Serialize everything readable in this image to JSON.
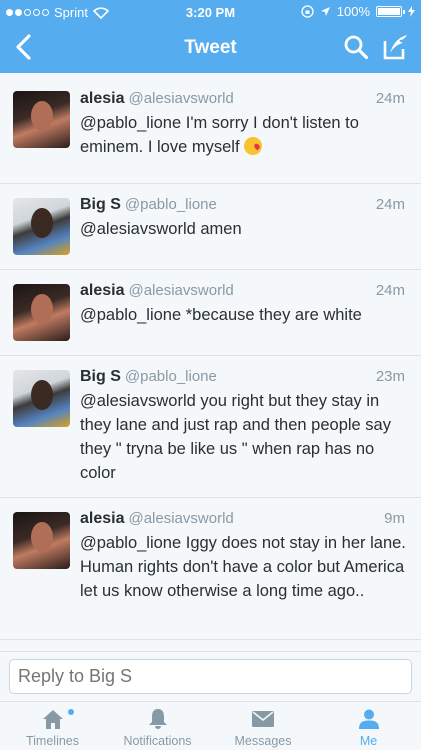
{
  "status_bar": {
    "carrier": "Sprint",
    "time": "3:20 PM",
    "battery": "100%"
  },
  "nav": {
    "title": "Tweet"
  },
  "tweets": [
    {
      "name": "alesia",
      "handle": "@alesiavsworld",
      "time": "24m",
      "text": "@pablo_lione I'm sorry I don't listen to eminem. I love myself",
      "emoji": "kissing-face-emoji",
      "avatar": "alesia"
    },
    {
      "name": "Big S",
      "handle": "@pablo_lione",
      "time": "24m",
      "text": "@alesiavsworld amen",
      "avatar": "bigs"
    },
    {
      "name": "alesia",
      "handle": "@alesiavsworld",
      "time": "24m",
      "text": "@pablo_lione *because they are white",
      "avatar": "alesia"
    },
    {
      "name": "Big S",
      "handle": "@pablo_lione",
      "time": "23m",
      "text": "@alesiavsworld you right but they stay in they lane and just rap and then people say they \" tryna be like us \" when rap has no color",
      "avatar": "bigs"
    },
    {
      "name": "alesia",
      "handle": "@alesiavsworld",
      "time": "9m",
      "text": "@pablo_lione Iggy does not stay in her lane. Human rights don't have a color but America let us know otherwise a long time ago..",
      "avatar": "alesia"
    }
  ],
  "reply": {
    "placeholder": "Reply to Big S"
  },
  "tabs": [
    {
      "label": "Timelines",
      "icon": "home-icon",
      "active": false
    },
    {
      "label": "Notifications",
      "icon": "bell-icon",
      "active": false
    },
    {
      "label": "Messages",
      "icon": "envelope-icon",
      "active": false
    },
    {
      "label": "Me",
      "icon": "person-icon",
      "active": true
    }
  ],
  "colors": {
    "brand": "#55acee",
    "text": "#292f33",
    "muted": "#8899a6"
  }
}
